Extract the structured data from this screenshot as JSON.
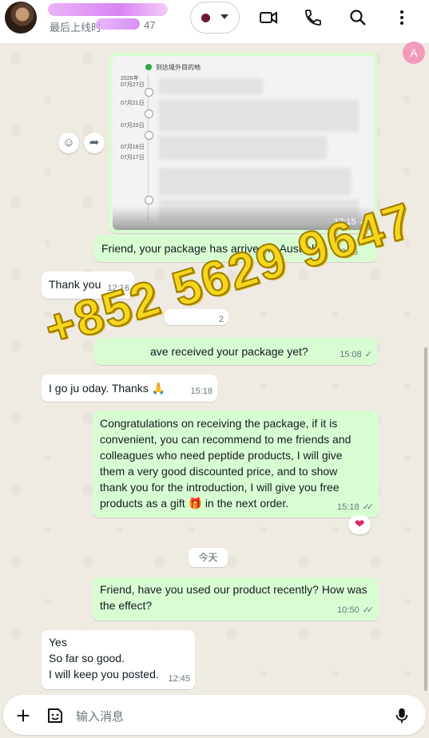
{
  "header": {
    "last_seen_prefix": "最后上线时",
    "last_seen_time": "47",
    "icons": [
      "video-call-icon",
      "voice-call-icon",
      "search-icon",
      "more-options-icon"
    ]
  },
  "translate_badge": "A",
  "image_message": {
    "dest_title": "到达境外目的地",
    "year": "2026年",
    "dates": [
      "07月27日",
      "07月21日",
      "07月20日",
      "07月18日",
      "07月17日"
    ],
    "time": "12:15"
  },
  "messages": [
    {
      "dir": "out",
      "text": "Friend, your package has arrived in Australia.",
      "time": "12:16"
    },
    {
      "dir": "in",
      "text": "Thank you",
      "time": "12:16"
    },
    {
      "dir": "out",
      "text": "ave received your package yet?",
      "time": "15:08"
    },
    {
      "dir": "in",
      "text": "I go ju    oday. Thanks 🙏",
      "time": "15:18"
    },
    {
      "dir": "out",
      "text": "Congratulations on receiving the package, if it is convenient, you can recommend to me friends and colleagues who need peptide products, I will give them a very good discounted price, and to show thank you for the introduction, I will give you free products as a gift 🎁 in the next order.",
      "time": "15:18"
    },
    {
      "dir": "out",
      "text": "Friend, have you used our product recently? How was the effect?",
      "time": "10:50"
    },
    {
      "dir": "in",
      "lines": [
        "Yes",
        "So far so good.",
        "I will keep you posted."
      ],
      "time": "12:45"
    }
  ],
  "partial_time": "2",
  "date_chip": "今天",
  "reaction": "❤",
  "watermark": "+852 5629 9647",
  "input": {
    "placeholder": "输入消息"
  },
  "colors": {
    "outgoing": "#d9fdd3",
    "incoming": "#ffffff",
    "watermark": "#f5d61d"
  }
}
